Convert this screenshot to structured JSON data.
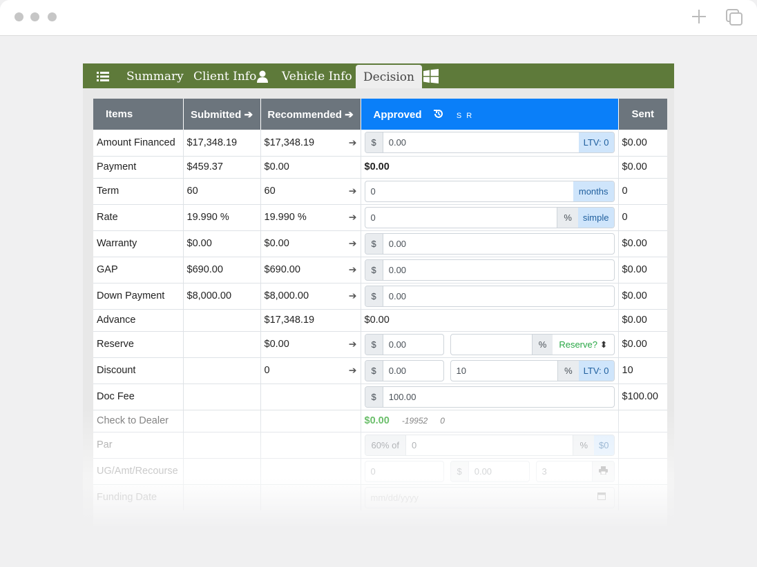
{
  "nav": {
    "tabs": [
      {
        "label": "Summary"
      },
      {
        "label": "Client Info"
      },
      {
        "label": "Vehicle Info"
      },
      {
        "label": "Decision"
      }
    ]
  },
  "table": {
    "headers": {
      "items": "Items",
      "submitted": "Submitted",
      "recommended": "Recommended",
      "approved": "Approved",
      "approved_initials": "S R",
      "sent": "Sent"
    },
    "rows": {
      "amount_financed": {
        "label": "Amount Financed",
        "submitted": "$17,348.19",
        "recommended": "$17,348.19",
        "prefix": "$",
        "value": "0.00",
        "suffix": "LTV: 0",
        "sent": "$0.00"
      },
      "payment": {
        "label": "Payment",
        "submitted": "$459.37",
        "recommended": "$0.00",
        "approved": "$0.00",
        "sent": "$0.00"
      },
      "term": {
        "label": "Term",
        "submitted": "60",
        "recommended": "60",
        "value": "0",
        "suffix": "months",
        "sent": "0"
      },
      "rate": {
        "label": "Rate",
        "submitted": "19.990 %",
        "recommended": "19.990 %",
        "value": "0",
        "suffix1": "%",
        "suffix2": "simple",
        "sent": "0"
      },
      "warranty": {
        "label": "Warranty",
        "submitted": "$0.00",
        "recommended": "$0.00",
        "prefix": "$",
        "value": "0.00",
        "sent": "$0.00"
      },
      "gap": {
        "label": "GAP",
        "submitted": "$690.00",
        "recommended": "$690.00",
        "prefix": "$",
        "value": "0.00",
        "sent": "$0.00"
      },
      "down_payment": {
        "label": "Down Payment",
        "submitted": "$8,000.00",
        "recommended": "$8,000.00",
        "prefix": "$",
        "value": "0.00",
        "sent": "$0.00"
      },
      "advance": {
        "label": "Advance",
        "recommended": "$17,348.19",
        "approved": "$0.00",
        "sent": "$0.00"
      },
      "reserve": {
        "label": "Reserve",
        "recommended": "$0.00",
        "prefix": "$",
        "value": "0.00",
        "pct_suffix": "%",
        "select": "Reserve?",
        "sent": "$0.00"
      },
      "discount": {
        "label": "Discount",
        "recommended": "0",
        "prefix": "$",
        "value": "0.00",
        "value2": "10",
        "pct_suffix": "%",
        "suffix": "LTV: 0",
        "sent": "10"
      },
      "doc_fee": {
        "label": "Doc Fee",
        "prefix": "$",
        "value": "100.00",
        "sent": "$100.00"
      },
      "check_to_dealer": {
        "label": "Check to Dealer",
        "approved": "$0.00",
        "note1": "-19952",
        "note2": "0"
      },
      "par": {
        "label": "Par",
        "prefix": "60% of",
        "value": "0",
        "pct_suffix": "%",
        "suffix": "$0"
      },
      "ug": {
        "label": "UG/Amt/Recourse",
        "value1": "0",
        "prefix": "$",
        "value2": "0.00",
        "value3": "3"
      },
      "funding_date": {
        "label": "Funding Date",
        "placeholder": "mm/dd/yyyy"
      }
    }
  },
  "colors": {
    "nav_green": "#5e7a3a",
    "header_gray": "#6c757d",
    "approved_blue": "#0a7ff9",
    "check_green": "#5cb85c"
  }
}
